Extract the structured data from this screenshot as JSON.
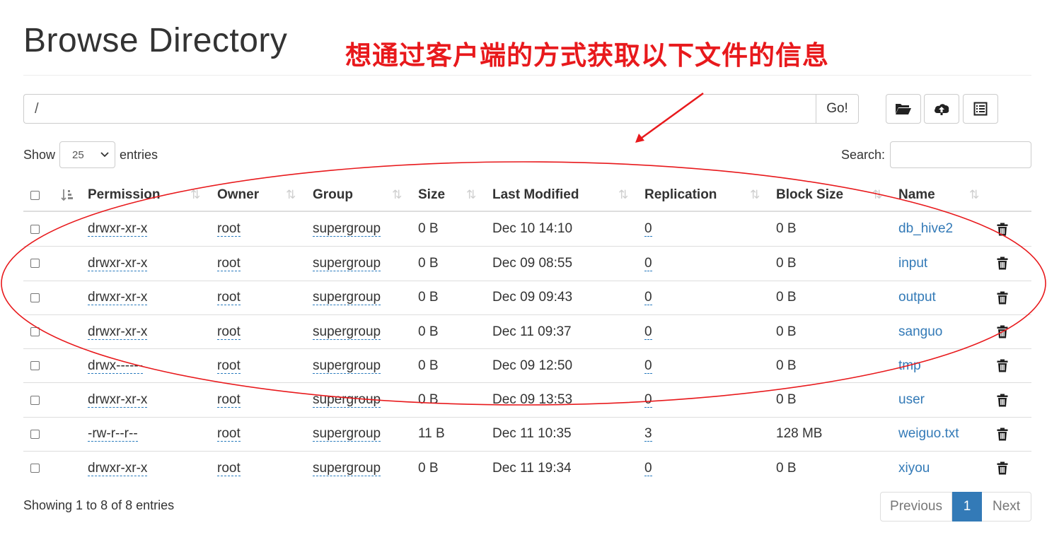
{
  "header": {
    "title": "Browse Directory",
    "annotation": "想通过客户端的方式获取以下文件的信息",
    "annotation_color": "#e8191c"
  },
  "path_bar": {
    "value": "/",
    "go_label": "Go!",
    "buttons": [
      "folder-open-icon",
      "cloud-upload-icon",
      "list-icon"
    ]
  },
  "length": {
    "prefix": "Show",
    "selected": "25",
    "suffix": "entries"
  },
  "search": {
    "label": "Search:",
    "value": ""
  },
  "table": {
    "columns": [
      "Permission",
      "Owner",
      "Group",
      "Size",
      "Last Modified",
      "Replication",
      "Block Size",
      "Name"
    ],
    "rows": [
      {
        "permission": "drwxr-xr-x",
        "owner": "root",
        "group": "supergroup",
        "size": "0 B",
        "modified": "Dec 10 14:10",
        "replication": "0",
        "block_size": "0 B",
        "name": "db_hive2"
      },
      {
        "permission": "drwxr-xr-x",
        "owner": "root",
        "group": "supergroup",
        "size": "0 B",
        "modified": "Dec 09 08:55",
        "replication": "0",
        "block_size": "0 B",
        "name": "input"
      },
      {
        "permission": "drwxr-xr-x",
        "owner": "root",
        "group": "supergroup",
        "size": "0 B",
        "modified": "Dec 09 09:43",
        "replication": "0",
        "block_size": "0 B",
        "name": "output"
      },
      {
        "permission": "drwxr-xr-x",
        "owner": "root",
        "group": "supergroup",
        "size": "0 B",
        "modified": "Dec 11 09:37",
        "replication": "0",
        "block_size": "0 B",
        "name": "sanguo"
      },
      {
        "permission": "drwx------",
        "owner": "root",
        "group": "supergroup",
        "size": "0 B",
        "modified": "Dec 09 12:50",
        "replication": "0",
        "block_size": "0 B",
        "name": "tmp"
      },
      {
        "permission": "drwxr-xr-x",
        "owner": "root",
        "group": "supergroup",
        "size": "0 B",
        "modified": "Dec 09 13:53",
        "replication": "0",
        "block_size": "0 B",
        "name": "user"
      },
      {
        "permission": "-rw-r--r--",
        "owner": "root",
        "group": "supergroup",
        "size": "11 B",
        "modified": "Dec 11 10:35",
        "replication": "3",
        "block_size": "128 MB",
        "name": "weiguo.txt"
      },
      {
        "permission": "drwxr-xr-x",
        "owner": "root",
        "group": "supergroup",
        "size": "0 B",
        "modified": "Dec 11 19:34",
        "replication": "0",
        "block_size": "0 B",
        "name": "xiyou"
      }
    ]
  },
  "footer": {
    "info": "Showing 1 to 8 of 8 entries",
    "previous": "Previous",
    "current_page": "1",
    "next": "Next"
  },
  "colors": {
    "link": "#337ab7",
    "active_page": "#337ab7",
    "annotation": "#e8191c"
  }
}
